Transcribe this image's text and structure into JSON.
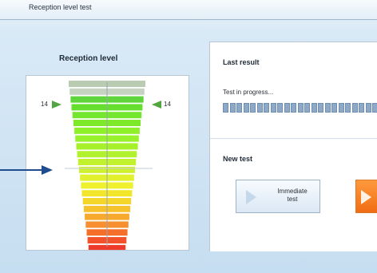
{
  "window": {
    "title": "Reception level test"
  },
  "reception": {
    "title": "Reception level",
    "left_value": "14",
    "right_value": "14",
    "colors": [
      "#b9cbb0",
      "#c6d3c0",
      "#5fd43b",
      "#66de2d",
      "#73e62d",
      "#7ee929",
      "#8df028",
      "#97f22c",
      "#a6f12a",
      "#b2f12d",
      "#c2f12e",
      "#cff12d",
      "#e2f12d",
      "#f0f12e",
      "#f2e62b",
      "#f4d52a",
      "#f6c22b",
      "#f7a92d",
      "#f78e2f",
      "#f56f2b",
      "#f2512a",
      "#ef3a2a",
      "#ea2c2b"
    ]
  },
  "last_result": {
    "title": "Last result",
    "status": "Test in progress..."
  },
  "new_test": {
    "title": "New test",
    "immediate_label_1": "Immediate",
    "immediate_label_2": "test"
  }
}
